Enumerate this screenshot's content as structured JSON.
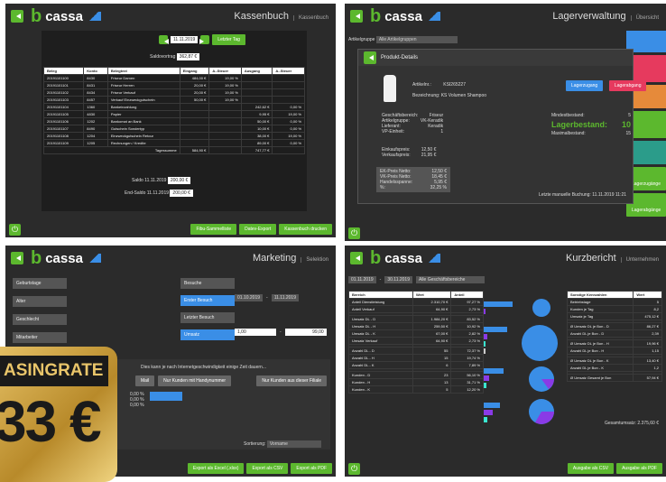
{
  "brand": "cassa",
  "kassenbuch": {
    "title": "Kassenbuch",
    "subtitle": "Kassenbuch",
    "date": "11.11.2019",
    "today_btn": "Letzter Tag",
    "saldovortrag_label": "Saldovortrag",
    "saldovortrag": "362,87 €",
    "headers": [
      "Beleg",
      "Konto",
      "Belegtext",
      "Eingang",
      "A.-Steuer",
      "Ausgang",
      "A.-Steuer"
    ],
    "rows": [
      [
        "20191101100",
        "8430",
        "Friseur Damen",
        "484,00 €",
        "19,00 %",
        "",
        ""
      ],
      [
        "20191101101",
        "8431",
        "Friseur Herren",
        "20,00 €",
        "19,00 %",
        "",
        ""
      ],
      [
        "20191101102",
        "8434",
        "Friseur Verkauf",
        "20,00 €",
        "19,00 %",
        "",
        ""
      ],
      [
        "20191101103",
        "8457",
        "Verkauf Einzweckgutschein",
        "50,00 €",
        "19,00 %",
        "",
        ""
      ],
      [
        "20191101104",
        "1360",
        "Bankeinzahlung",
        "",
        "",
        "242,62 €",
        "0,00 %"
      ],
      [
        "20191101105",
        "4830",
        "Papier",
        "",
        "",
        "9,95 €",
        "19,00 %"
      ],
      [
        "20191101106",
        "1202",
        "Bankomat an Bank",
        "",
        "",
        "50,00 €",
        "0,00 %"
      ],
      [
        "20191101107",
        "8490",
        "Gutschein Sondertyp",
        "",
        "",
        "10,00 €",
        "0,00 %"
      ],
      [
        "20191101108",
        "1204",
        "Einzweckgutschein Retour",
        "",
        "",
        "38,00 €",
        "19,00 %"
      ],
      [
        "20191101109",
        "1205",
        "Rechnungen / Kredite",
        "",
        "",
        "89,00 €",
        "0,00 %"
      ]
    ],
    "tagessumme_label": "Tagessumme",
    "tagessumme_in": "584,90 €",
    "tagessumme_out": "747,77 €",
    "saldo_label": "Saldo 11.11.2019",
    "saldo": "200,00 €",
    "endsaldo_label": "End-Saldo 11.11.2019",
    "endsaldo": "200,00 €",
    "btn_fibu": "Fibu-Sammelliste",
    "btn_datev": "Datev-Export",
    "btn_drucken": "Kassenbuch drucken"
  },
  "lager": {
    "title": "Lagerverwaltung",
    "subtitle": "Übersicht",
    "artikelgruppe_label": "Artikelgruppe",
    "artikelgruppe": "Alle Artikelgruppen",
    "dialog_title": "Produkt-Details",
    "artikelnr_label": "Artikelnr.:",
    "artikelnr": "KSI265227",
    "bezeichnung_label": "Bezeichnung:",
    "bezeichnung": "KS Volumen Shampoo",
    "btn_zugang": "Lagerzugang",
    "btn_abgang": "Lagerabgang",
    "details": [
      [
        "Geschäftsbereich:",
        "Friseur"
      ],
      [
        "Artikelgruppe:",
        "VK-Keradik"
      ],
      [
        "Lieferant:",
        "Keradik"
      ],
      [
        "VP-Einheit:",
        "1"
      ]
    ],
    "prices": [
      [
        "Einkaufspreis:",
        "12,50 €"
      ],
      [
        "Verkaufspreis:",
        "21,95 €"
      ]
    ],
    "netto": [
      [
        "EK-Preis Netto:",
        "12,50 €"
      ],
      [
        "VK-Preis Netto:",
        "18,45 €"
      ],
      [
        "Handelsspanne:",
        "5,95 €"
      ],
      [
        "%:",
        "32,25 %"
      ]
    ],
    "mindest_label": "Mindestbestand:",
    "mindest": "5",
    "bestand_label": "Lagerbestand:",
    "bestand": "10",
    "max_label": "Maximalbestand:",
    "max": "15",
    "letzte": "Letzte manuelle Buchung: 11.11.2019 11:21",
    "side_btn": "Lagerzugänge",
    "side_btn2": "Lagerabgänge"
  },
  "marketing": {
    "title": "Marketing",
    "subtitle": "Selektion",
    "left": [
      "Geburtstage",
      "Alter",
      "Geschlecht",
      "Mitarbeiter"
    ],
    "right": [
      "Besuche",
      "Erster Besuch",
      "Letzter Besuch",
      "Umsatz"
    ],
    "date_from": "01.10.2019",
    "date_to": "11.11.2019",
    "umsatz_from": "1,00",
    "umsatz_to": "99,00",
    "wait": "Dies kann je nach Internetgeschwindigkeit einige Zeit dauern...",
    "btn_mail": "Mail",
    "btn_handy": "Nur Kunden mit Handynummer",
    "btn_filiale": "Nur Kunden aus dieser Filiale",
    "sort_label": "Sortierung:",
    "sort": "Vorname",
    "btn_excel": "Export als Excel (.xlsx)",
    "btn_csv": "Export als CSV",
    "btn_pdf": "Export als PDF",
    "pcts": [
      "0,00 %",
      "0,00 %",
      "0,00 %"
    ],
    "badge_top": "ASINGRATE",
    "badge_bottom": "33 €"
  },
  "kurz": {
    "title": "Kurzbericht",
    "subtitle": "Unternehmen",
    "date_from": "01.11.2019",
    "date_to": "30.11.2019",
    "bereich": "Alle Geschäftsbereiche",
    "headers": [
      "Bereich",
      "Wert",
      "Anteil"
    ],
    "rows": [
      [
        "Anteil Dienstleistung",
        "2.310,70 €",
        "97,27 %"
      ],
      [
        "Anteil Verkauf",
        "64,90 €",
        "2,73 %"
      ],
      [
        "",
        "",
        " "
      ],
      [
        "Umsatz DL - D",
        "1.984,20 €",
        "83,52 %"
      ],
      [
        "Umsatz DL - H",
        "259,50 €",
        "10,92 %"
      ],
      [
        "Umsatz DL - K",
        "67,00 €",
        "2,82 %"
      ],
      [
        "Umsatz Verkauf",
        "64,90 €",
        "2,73 %"
      ],
      [
        "",
        " ",
        " "
      ],
      [
        "Anzahl DL - D",
        "55",
        "72,37 %"
      ],
      [
        "Anzahl DL - H",
        "15",
        "19,74 %"
      ],
      [
        "Anzahl DL - K",
        "6",
        "7,89 %"
      ],
      [
        "",
        " ",
        " "
      ],
      [
        "Kunden - D",
        "23",
        "56,10 %"
      ],
      [
        "Kunden - H",
        "13",
        "31,71 %"
      ],
      [
        "Kunden - K",
        "5",
        "12,20 %"
      ]
    ],
    "k_headers": [
      "Sonstige Kennzahlen",
      "Wert"
    ],
    "k_rows": [
      [
        "Betriebstage",
        "5"
      ],
      [
        "Kunden je Tag",
        "8,2"
      ],
      [
        "Umsatz je Tag",
        "475,12 €"
      ],
      [
        "",
        ""
      ],
      [
        "Ø Umsatz DL je Bon - D",
        "86,27 €"
      ],
      [
        "Anzahl DL je Bon - D",
        "2,39"
      ],
      [
        "",
        ""
      ],
      [
        "Ø Umsatz DL je Bon - H",
        "19,96 €"
      ],
      [
        "Anzahl DL je Bon - H",
        "1,15"
      ],
      [
        "",
        ""
      ],
      [
        "Ø Umsatz DL je Bon - K",
        "13,40 €"
      ],
      [
        "Anzahl DL je Bon - K",
        "1,2"
      ],
      [
        "",
        ""
      ],
      [
        "Ø Umsatz Gesamt je Bon",
        "57,94 €"
      ]
    ],
    "gesamt": "Gesamtumsatz: 2.375,60 €",
    "btn_csv": "Ausgabe als CSV",
    "btn_pdf": "Ausgabe als PDF"
  }
}
